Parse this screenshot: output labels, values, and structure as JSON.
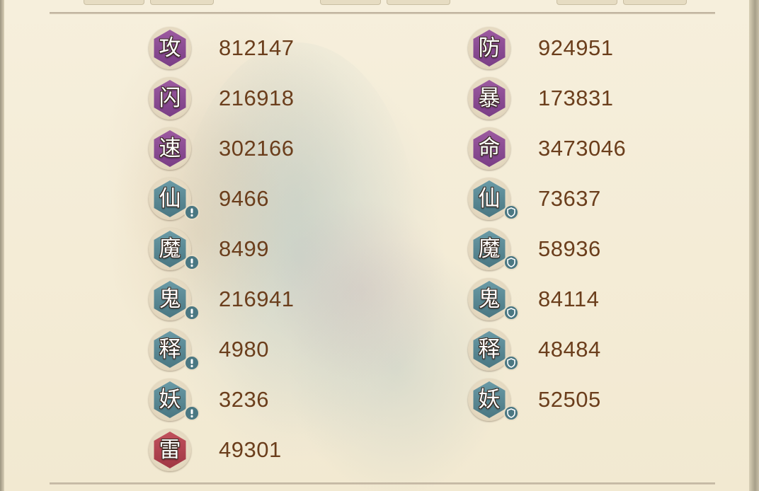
{
  "stats_left": [
    {
      "glyph": "攻",
      "value": "812147"
    },
    {
      "glyph": "闪",
      "value": "216918"
    },
    {
      "glyph": "速",
      "value": "302166"
    },
    {
      "glyph": "仙",
      "value": "9466"
    },
    {
      "glyph": "魔",
      "value": "8499"
    },
    {
      "glyph": "鬼",
      "value": "216941"
    },
    {
      "glyph": "释",
      "value": "4980"
    },
    {
      "glyph": "妖",
      "value": "3236"
    },
    {
      "glyph": "雷",
      "value": "49301"
    }
  ],
  "stats_right": [
    {
      "glyph": "防",
      "value": "924951"
    },
    {
      "glyph": "暴",
      "value": "173831"
    },
    {
      "glyph": "命",
      "value": "3473046"
    },
    {
      "glyph": "仙",
      "value": "73637"
    },
    {
      "glyph": "魔",
      "value": "58936"
    },
    {
      "glyph": "鬼",
      "value": "84114"
    },
    {
      "glyph": "释",
      "value": "48484"
    },
    {
      "glyph": "妖",
      "value": "52505"
    }
  ],
  "colors": {
    "purple_badge": "#8a4a92",
    "teal_badge": "#5a8792",
    "red_badge": "#b0404e",
    "value_text": "#6b3e1c",
    "background": "#f4ecd6"
  },
  "icons": {
    "attack_mark": "exclamation-icon",
    "defense_mark": "shield-icon"
  }
}
